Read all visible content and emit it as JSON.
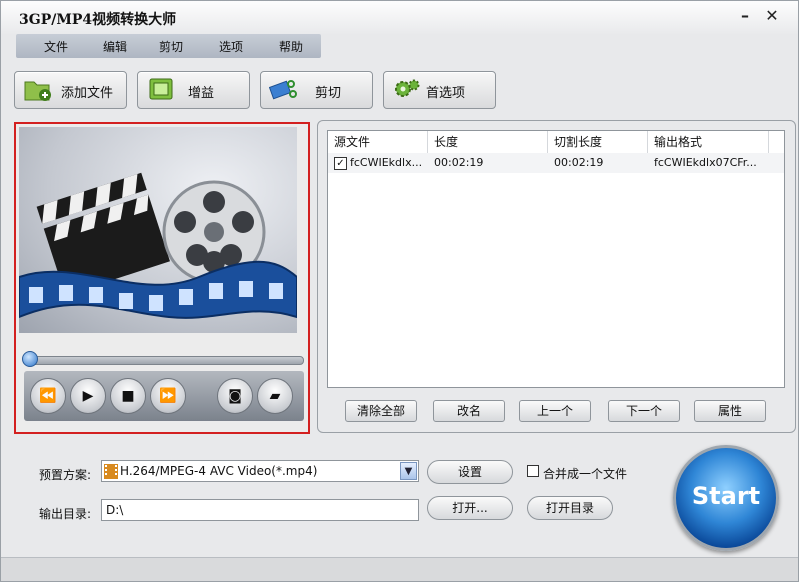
{
  "app": {
    "title": "3GP/MP4视频转换大师",
    "minimize": "–",
    "close": "✕"
  },
  "menu": [
    "文件",
    "编辑",
    "剪切",
    "选项",
    "帮助"
  ],
  "toolbar": {
    "add_file": "添加文件",
    "gain": "增益",
    "cut": "剪切",
    "preferences": "首选项"
  },
  "table": {
    "headers": [
      "源文件",
      "长度",
      "切割长度",
      "输出格式"
    ],
    "rows": [
      {
        "checked": true,
        "source": "fcCWIEkdlx...",
        "length": "00:02:19",
        "cut_length": "00:02:19",
        "output": "fcCWIEkdlx07CFr..."
      }
    ]
  },
  "list_buttons": {
    "clear_all": "清除全部",
    "rename": "改名",
    "prev": "上一个",
    "next": "下一个",
    "properties": "属性"
  },
  "settings": {
    "preset_label": "预置方案:",
    "preset_value": "H.264/MPEG-4 AVC Video(*.mp4)",
    "setup_button": "设置",
    "merge_label": "合并成一个文件",
    "merge_checked": false,
    "output_label": "输出目录:",
    "output_value": "D:\\",
    "open_button": "打开...",
    "open_dir_button": "打开目录"
  },
  "start": "Start",
  "colors": {
    "preview_border": "#d32020",
    "start_blue": "#2f86d6"
  }
}
